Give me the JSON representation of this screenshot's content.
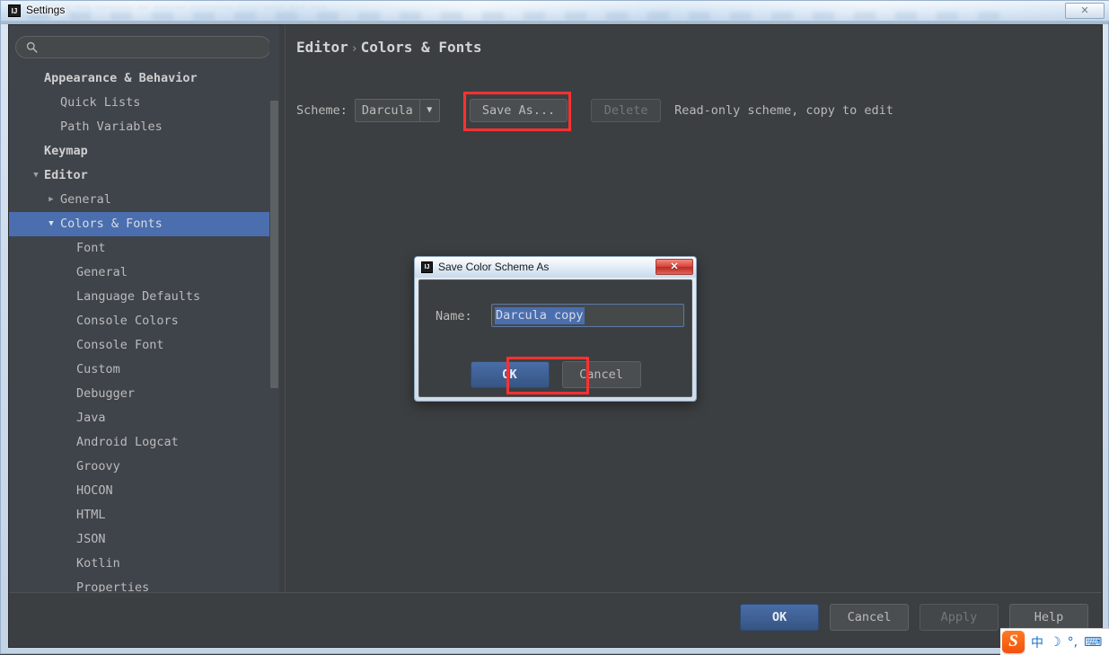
{
  "window": {
    "title": "Settings",
    "app_icon": "IJ",
    "close_label": "✕",
    "ghost_text": "... ... ....... .. ......  ........ ....  .... ... ..."
  },
  "search": {
    "value": "",
    "placeholder": "",
    "icon": "search-icon"
  },
  "sidebar": {
    "items": [
      {
        "label": "Appearance & Behavior",
        "level": 1,
        "group": true,
        "twisty": "",
        "selected": false
      },
      {
        "label": "Quick Lists",
        "level": 2,
        "group": false,
        "twisty": "",
        "selected": false
      },
      {
        "label": "Path Variables",
        "level": 2,
        "group": false,
        "twisty": "",
        "selected": false
      },
      {
        "label": "Keymap",
        "level": 1,
        "group": true,
        "twisty": "",
        "selected": false
      },
      {
        "label": "Editor",
        "level": 1,
        "group": true,
        "twisty": "▼",
        "selected": false
      },
      {
        "label": "General",
        "level": 2,
        "group": false,
        "twisty": "▶",
        "selected": false
      },
      {
        "label": "Colors & Fonts",
        "level": 2,
        "group": false,
        "twisty": "▼",
        "selected": true
      },
      {
        "label": "Font",
        "level": 3,
        "group": false,
        "twisty": "",
        "selected": false
      },
      {
        "label": "General",
        "level": 3,
        "group": false,
        "twisty": "",
        "selected": false
      },
      {
        "label": "Language Defaults",
        "level": 3,
        "group": false,
        "twisty": "",
        "selected": false
      },
      {
        "label": "Console Colors",
        "level": 3,
        "group": false,
        "twisty": "",
        "selected": false
      },
      {
        "label": "Console Font",
        "level": 3,
        "group": false,
        "twisty": "",
        "selected": false
      },
      {
        "label": "Custom",
        "level": 3,
        "group": false,
        "twisty": "",
        "selected": false
      },
      {
        "label": "Debugger",
        "level": 3,
        "group": false,
        "twisty": "",
        "selected": false
      },
      {
        "label": "Java",
        "level": 3,
        "group": false,
        "twisty": "",
        "selected": false
      },
      {
        "label": "Android Logcat",
        "level": 3,
        "group": false,
        "twisty": "",
        "selected": false
      },
      {
        "label": "Groovy",
        "level": 3,
        "group": false,
        "twisty": "",
        "selected": false
      },
      {
        "label": "HOCON",
        "level": 3,
        "group": false,
        "twisty": "",
        "selected": false
      },
      {
        "label": "HTML",
        "level": 3,
        "group": false,
        "twisty": "",
        "selected": false
      },
      {
        "label": "JSON",
        "level": 3,
        "group": false,
        "twisty": "",
        "selected": false
      },
      {
        "label": "Kotlin",
        "level": 3,
        "group": false,
        "twisty": "",
        "selected": false
      },
      {
        "label": "Properties",
        "level": 3,
        "group": false,
        "twisty": "",
        "selected": false
      }
    ]
  },
  "content": {
    "breadcrumb": {
      "root": "Editor",
      "separator": "›",
      "leaf": "Colors & Fonts"
    },
    "scheme": {
      "label": "Scheme:",
      "value": "Darcula",
      "arrow": "▼",
      "save_as_label": "Save As...",
      "delete_label": "Delete",
      "readonly_note": "Read-only scheme, copy to edit"
    }
  },
  "footer": {
    "ok_label": "OK",
    "cancel_label": "Cancel",
    "apply_label": "Apply",
    "help_label": "Help"
  },
  "dialog": {
    "title": "Save Color Scheme As",
    "app_icon": "IJ",
    "close_label": "✕",
    "name_label": "Name:",
    "name_value": "Darcula copy",
    "ok_label": "OK",
    "cancel_label": "Cancel"
  },
  "ime": {
    "logo": "S",
    "mode": "中",
    "moon": "☽",
    "degree": "°,",
    "keyboard": "⌨"
  },
  "colors": {
    "accent_selection": "#4b6eaf",
    "panel_bg": "#3f434a",
    "content_bg": "#3c3f41",
    "annotation_red": "#ff3131",
    "text": "#bbbbbb"
  }
}
